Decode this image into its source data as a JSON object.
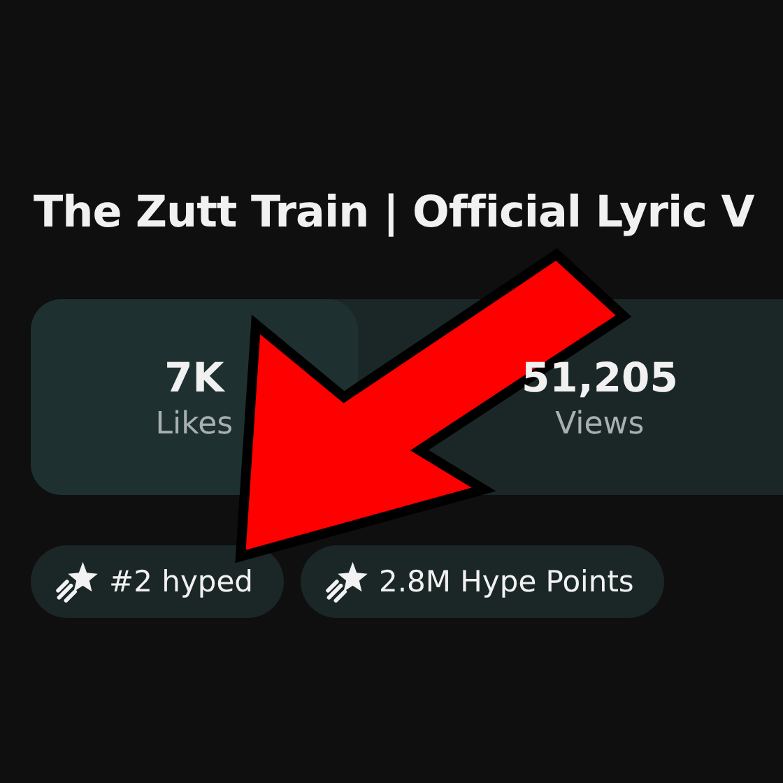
{
  "title": "The Zutt Train | Official Lyric V",
  "stats": [
    {
      "value": "7K",
      "label": "Likes"
    },
    {
      "value": "51,205",
      "label": "Views"
    }
  ],
  "chips": [
    {
      "label": "#2 hyped"
    },
    {
      "label": "2.8M Hype Points"
    }
  ]
}
